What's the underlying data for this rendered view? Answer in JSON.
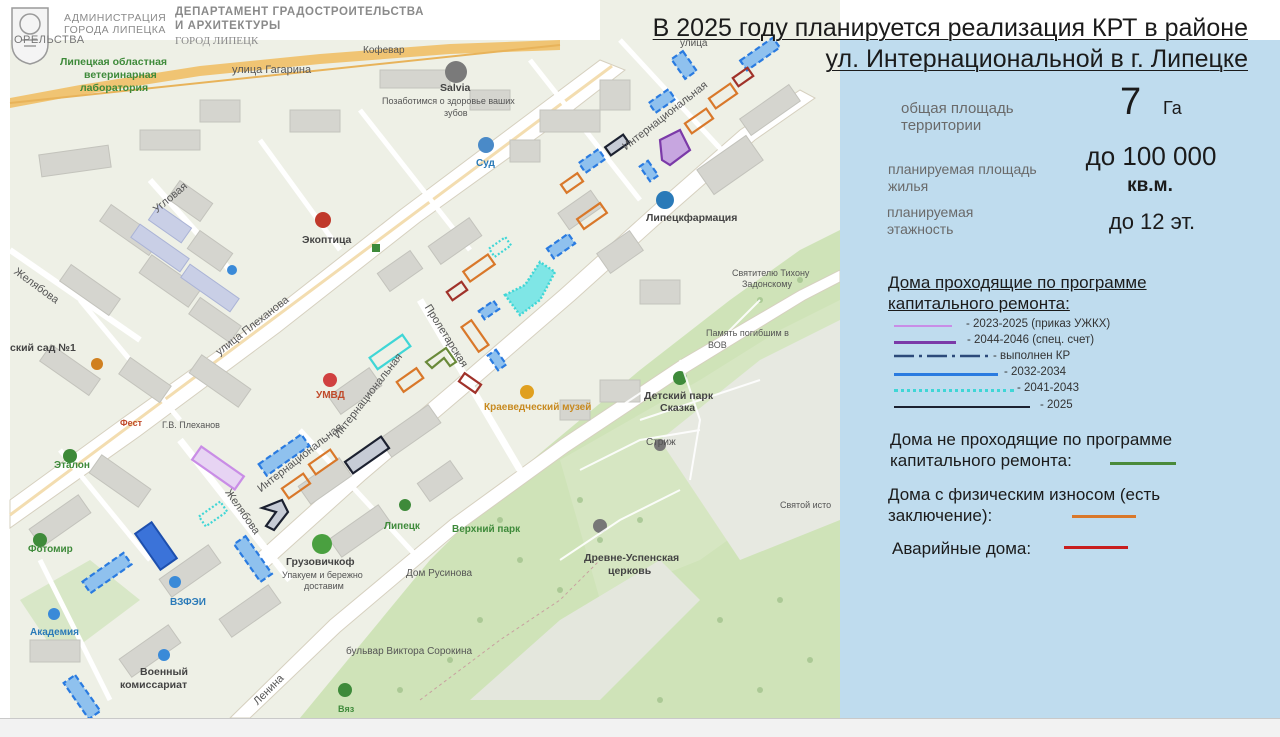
{
  "header": {
    "admin_line1": "АДМИНИСТРАЦИЯ",
    "admin_line2": "ГОРОДА ЛИПЕЦКА",
    "dept_line1": "ДЕПАРТАМЕНТ  ГРАДОСТРОИТЕЛЬСТВА",
    "dept_line2": "И АРХИТЕКТУРЫ",
    "city": "ГОРОД ЛИПЕЦК"
  },
  "title": {
    "line1": "В 2025 году планируется реализация КРТ в районе",
    "line2": "ул. Интернациональной в г. Липецке"
  },
  "stats": {
    "area_label": "общая площадь территории",
    "area_value": "7",
    "area_unit": "Га",
    "housing_label": "планируемая площадь жилья",
    "housing_value": "до 100 000",
    "housing_unit": "кв.м.",
    "floors_label": "планируемая этажность",
    "floors_value": "до 12 эт."
  },
  "legend": {
    "title_line1": "Дома проходящие по программе",
    "title_line2": "капитального ремонта:",
    "items": [
      {
        "label": "- 2023-2025  (приказ УЖКХ)",
        "color": "#c98de6",
        "style": "solid"
      },
      {
        "label": "- 2044-2046  (спец. счет)",
        "color": "#7b3aa8",
        "style": "solid"
      },
      {
        "label": "- выполнен КР",
        "color": "#2c4a7a",
        "style": "dashdot"
      },
      {
        "label": "- 2032-2034",
        "color": "#2a7be0",
        "style": "solid"
      },
      {
        "label": "- 2041-2043",
        "color": "#3fd6d6",
        "style": "dotted"
      },
      {
        "label": "- 2025",
        "color": "#1c2130",
        "style": "solid"
      }
    ],
    "not_in_program": "Дома не проходящие по программе капитального ремонта:",
    "not_in_program_color": "#4a8a3a",
    "wear": "Дома с физическим износом (есть заключение):",
    "wear_color": "#d9782a",
    "emergency": "Аварийные дома:",
    "emergency_color": "#c81e1e"
  },
  "map": {
    "streets": {
      "gagarina": "улица Гагарина",
      "plekhanova": "улица Плеханова",
      "internatsionalnaya_top": "Интернациональная",
      "internatsionalnaya_mid": "Интернациональная",
      "internatsionalnaya_low": "Интернациональная",
      "proletarskaya": "Пролетарская",
      "zhelyabova_left": "Желябова",
      "zhelyabova_low": "Желябова",
      "uglovaya": "Угловая",
      "lenina": "Ленина",
      "bulvar": "бульвар Виктора Сорокина",
      "kofevar": "Кофевар",
      "ulitsa": "улица"
    },
    "pois": {
      "lab_l1": "Липецкая областная",
      "lab_l2": "ветеринарная",
      "lab_l3": "лаборатория",
      "salvia": "Salvia",
      "salvia_note_l1": "Позаботимся о здоровье ваших",
      "salvia_note_l2": "зубов",
      "sud": "Суд",
      "ekoptica": "Экоптица",
      "lipetskfarmatsiya": "Липецкфармация",
      "svyatitelyu_l1": "Святителю Тихону",
      "svyatitelyu_l2": "Задонскому",
      "pamyatnik_l1": "Память погибшим в",
      "pamyatnik_l2": "ВОВ",
      "detsky_park_l1": "Детский парк",
      "detsky_park_l2": "Сказка",
      "kraeved": "Краеведческий музей",
      "umvd": "УМВД",
      "fest": "Фест",
      "plekhanov": "Г.В. Плеханов",
      "etalon": "Эталон",
      "strizh": "Стриж",
      "verkhny_park": "Верхний парк",
      "lipetsk": "Липецк",
      "gruzovichkof": "Грузовичкоф",
      "gruz_note_l1": "Упакуем и бережно",
      "gruz_note_l2": "доставим",
      "drevne_l1": "Древне-Успенская",
      "drevne_l2": "церковь",
      "dom_rusinova": "Дом Русинова",
      "fotomir": "Фотомир",
      "vzfei": "ВЗФЭИ",
      "akademiya": "Академия",
      "voenkom_l1": "Военный",
      "voenkom_l2": "комиссариат",
      "svyatoy_istochnik": "Святой исто",
      "detsad": "ский сад №1",
      "vyaz": "Вяз",
      "kerelstva": "ОРЕЛЬСТВА"
    }
  }
}
